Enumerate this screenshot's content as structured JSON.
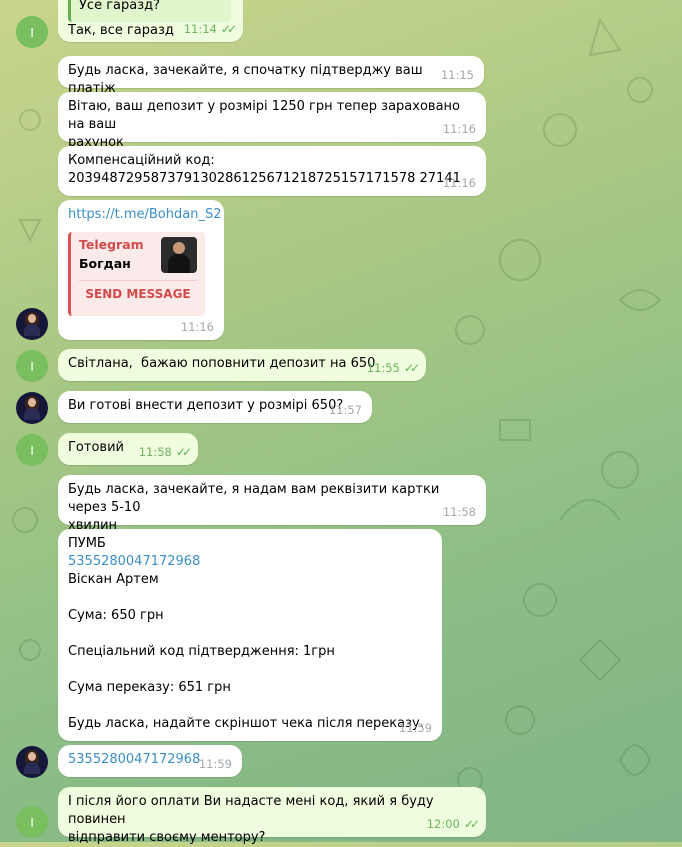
{
  "quoted_reply": {
    "text": "Усе гаразд?"
  },
  "avatars": {
    "me_initial": "I"
  },
  "messages": [
    {
      "id": "m1",
      "text": "Так, все гаразд",
      "time": "11:14",
      "outgoing": true
    },
    {
      "id": "m2",
      "text": "Будь ласка, зачекайте, я спочатку підтверджу ваш платіж",
      "time": "11:15",
      "outgoing": false
    },
    {
      "id": "m3",
      "text": "Вітаю, ваш депозит у розмірі 1250 грн тепер зараховано на ваш\nрахунок",
      "time": "11:16",
      "outgoing": false
    },
    {
      "id": "m4",
      "text": "Компенсаційний код:\n203948729587379130286125671218725157171578 27141",
      "time": "11:16",
      "outgoing": false
    },
    {
      "id": "m5",
      "link": "https://t.me/Bohdan_S2",
      "time": "11:16",
      "outgoing": false,
      "preview": {
        "site": "Telegram",
        "title": "Богдан",
        "button": "SEND MESSAGE"
      }
    },
    {
      "id": "m6",
      "text": "Світлана,  бажаю поповнити депозит на 650",
      "time": "11:55",
      "outgoing": true
    },
    {
      "id": "m7",
      "text": "Ви готові внести депозит у розмірі 650?",
      "time": "11:57",
      "outgoing": false
    },
    {
      "id": "m8",
      "text": "Готовий",
      "time": "11:58",
      "outgoing": true
    },
    {
      "id": "m9",
      "text": "Будь ласка, зачекайте, я надам вам реквізити картки через 5-10\nхвилин",
      "time": "11:58",
      "outgoing": false
    },
    {
      "id": "m10",
      "bank": "ПУМБ",
      "card": "5355280047172968",
      "name": "Віскан Артем",
      "amount": "Сума: 650 грн",
      "code": "Спеціальний код підтвердження: 1грн",
      "total": "Сума переказу: 651 грн",
      "note": "Будь ласка, надайте скріншот чека після переказу.",
      "time": "11:59",
      "outgoing": false
    },
    {
      "id": "m11",
      "link": "5355280047172968",
      "time": "11:59",
      "outgoing": false
    },
    {
      "id": "m12",
      "text": "І після його оплати Ви надасте мені код, який я буду повинен\nвідправити своєму ментору?",
      "time": "12:00",
      "outgoing": true
    }
  ],
  "colors": {
    "outgoing_bubble": "#effdde",
    "incoming_bubble": "#ffffff",
    "link": "#3a8fc6",
    "check": "#5fb653"
  }
}
